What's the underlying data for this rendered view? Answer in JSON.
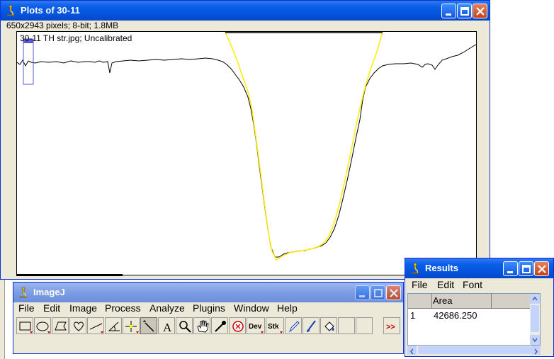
{
  "plot_window": {
    "title": "Plots of 30-11",
    "info": "650x2943 pixels; 8-bit; 1.8MB",
    "plot_label": "30-11 TH str.jpg; Uncalibrated"
  },
  "imagej_window": {
    "title": "ImageJ",
    "menu": [
      "File",
      "Edit",
      "Image",
      "Process",
      "Analyze",
      "Plugins",
      "Window",
      "Help"
    ],
    "tools": [
      {
        "name": "rectangle-tool-icon"
      },
      {
        "name": "oval-tool-icon"
      },
      {
        "name": "polygon-tool-icon"
      },
      {
        "name": "freehand-tool-icon"
      },
      {
        "name": "line-tool-icon"
      },
      {
        "name": "angle-tool-icon"
      },
      {
        "name": "point-tool-icon"
      },
      {
        "name": "wand-tool-icon"
      },
      {
        "name": "text-tool-icon"
      },
      {
        "name": "magnifier-tool-icon"
      },
      {
        "name": "hand-tool-icon"
      },
      {
        "name": "color-picker-icon"
      },
      {
        "name": "stop-icon"
      },
      {
        "name": "dev-menu-icon"
      },
      {
        "name": "stk-menu-icon"
      },
      {
        "name": "pencil-tool-icon"
      },
      {
        "name": "brush-tool-icon"
      },
      {
        "name": "flood-fill-tool-icon"
      },
      {
        "name": "more-tools-icon"
      }
    ],
    "dev_label": "Dev",
    "stk_label": "Stk",
    "more_label": ">>",
    "text_tool_label": "A"
  },
  "results_window": {
    "title": "Results",
    "menu": [
      "File",
      "Edit",
      "Font"
    ],
    "column_header": "Area",
    "rows": [
      {
        "index": "1",
        "area": "42686.250"
      }
    ]
  },
  "colors": {
    "title_blue": "#0a5ee8",
    "profile_line": "#000000",
    "selection_line": "#ffff00"
  }
}
